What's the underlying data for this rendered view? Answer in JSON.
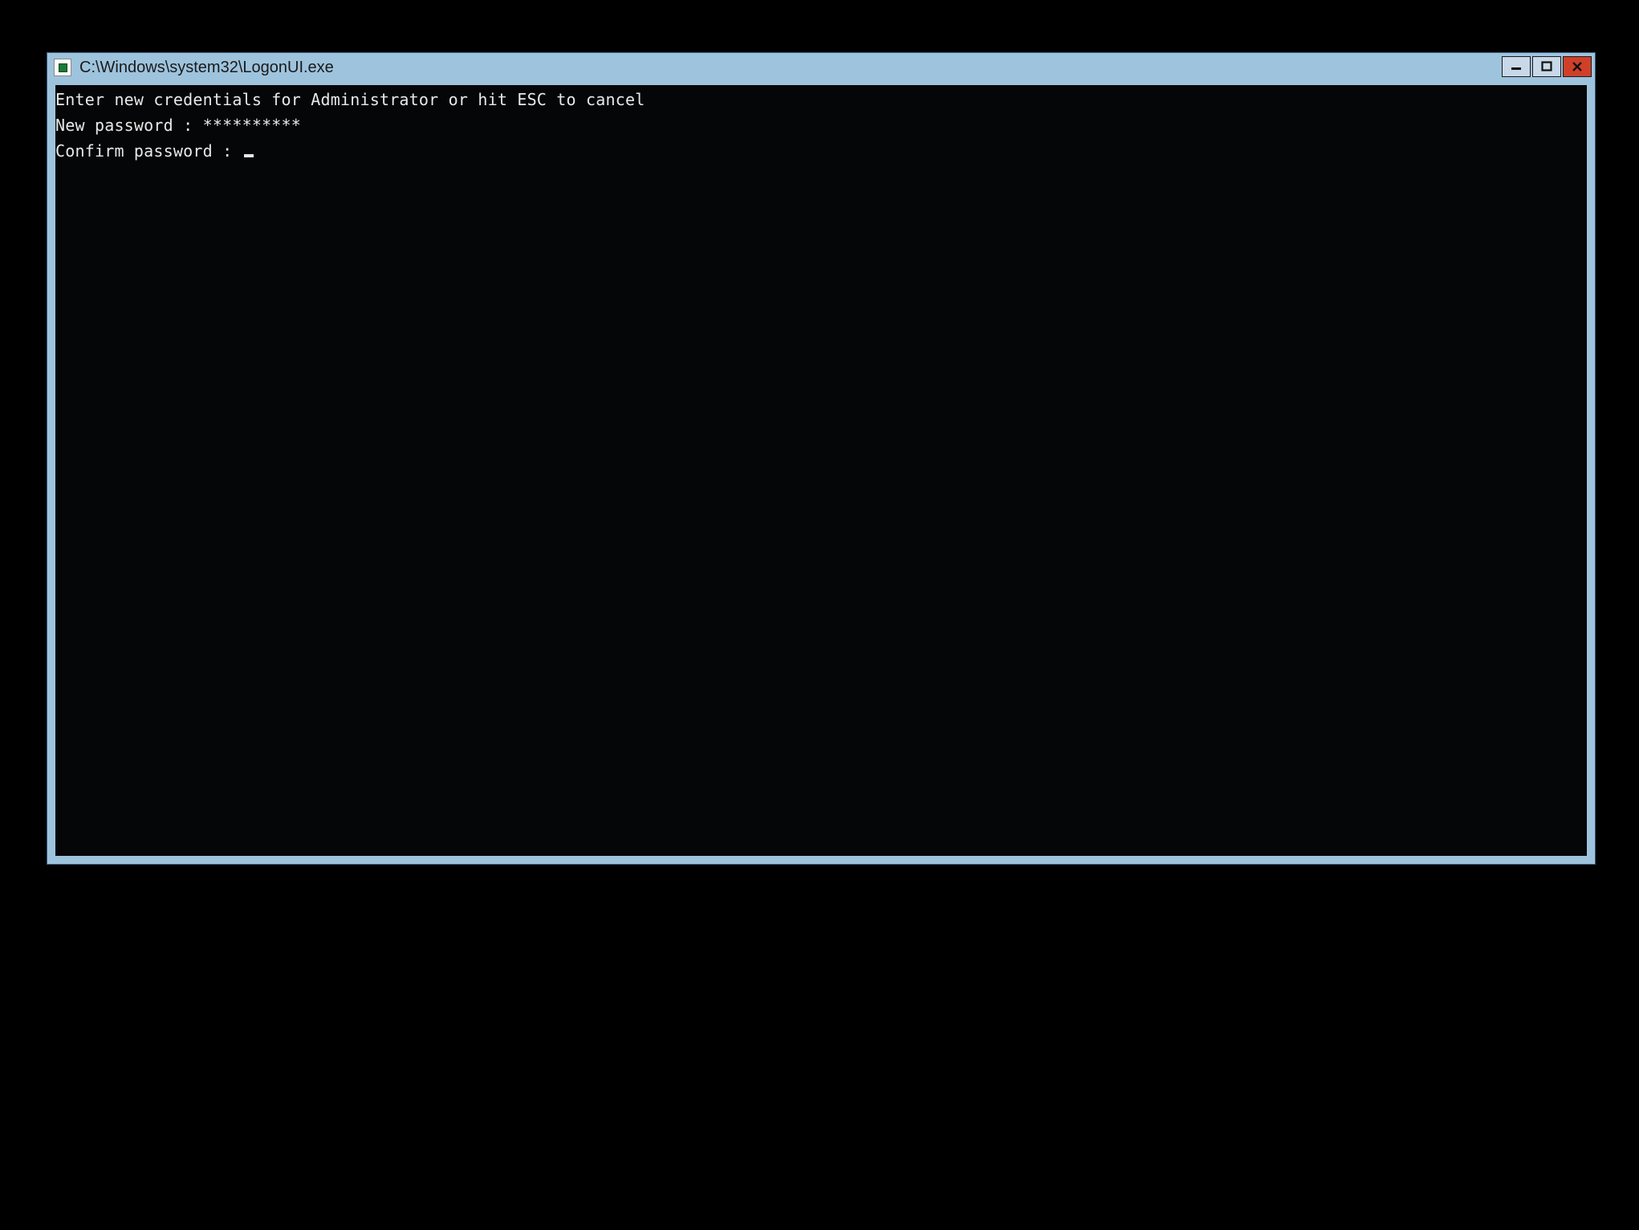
{
  "window": {
    "title": "C:\\Windows\\system32\\LogonUI.exe"
  },
  "console": {
    "line1": "Enter new credentials for Administrator or hit ESC to cancel",
    "line2_label": "New password : ",
    "line2_value": "**********",
    "line3_label": "Confirm password : ",
    "line3_value": ""
  }
}
